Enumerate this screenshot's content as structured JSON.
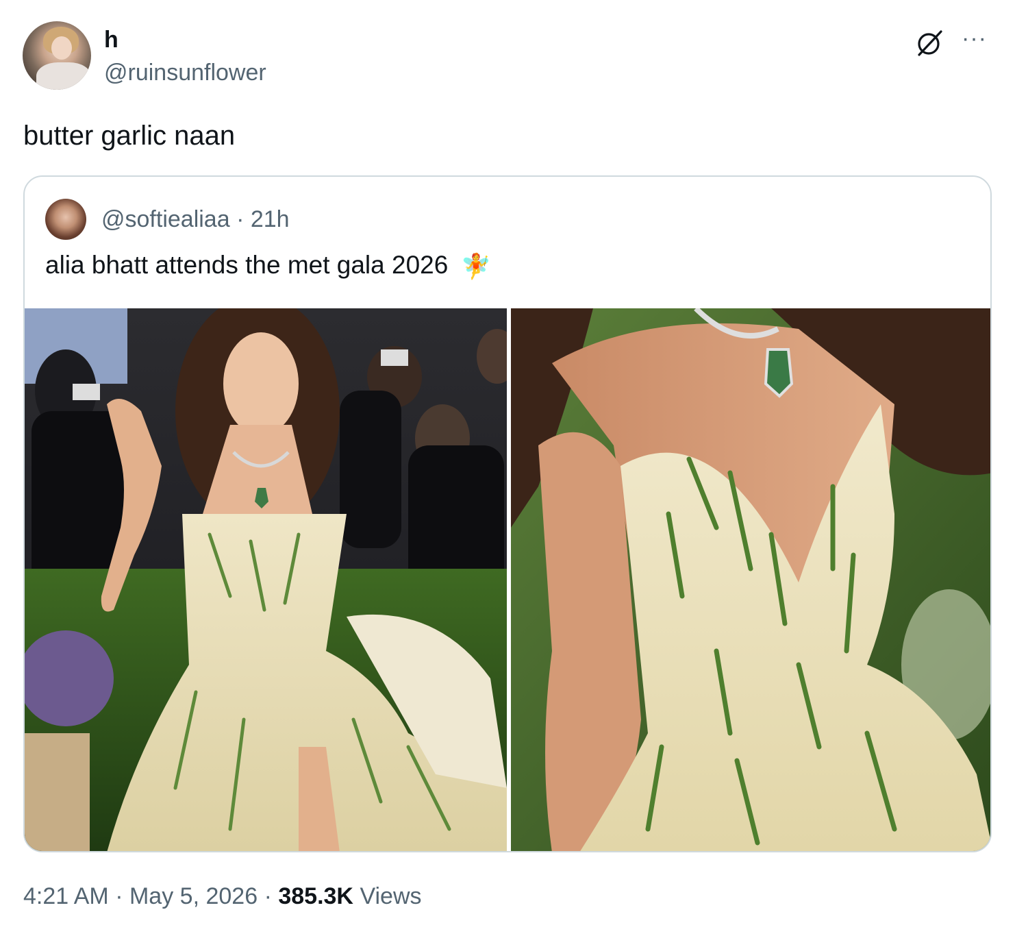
{
  "author": {
    "display_name": "h",
    "handle": "@ruinsunflower"
  },
  "tweet": {
    "text": "butter garlic naan"
  },
  "quoted_tweet": {
    "handle": "@softiealiaa",
    "separator": "·",
    "age": "21h",
    "text": "alia bhatt attends the met gala 2026",
    "emoji": "🧚",
    "media": [
      "photo-full-gown",
      "photo-bodice-closeup"
    ]
  },
  "meta": {
    "time": "4:21 AM",
    "separator": "·",
    "date": "May 5, 2026",
    "views_count": "385.3K",
    "views_label": "Views"
  },
  "icons": {
    "grok": "grok-slash-icon",
    "more": "more-dots-icon"
  },
  "colors": {
    "text_primary": "#0f1419",
    "text_secondary": "#536471",
    "border": "#cfd9de"
  }
}
